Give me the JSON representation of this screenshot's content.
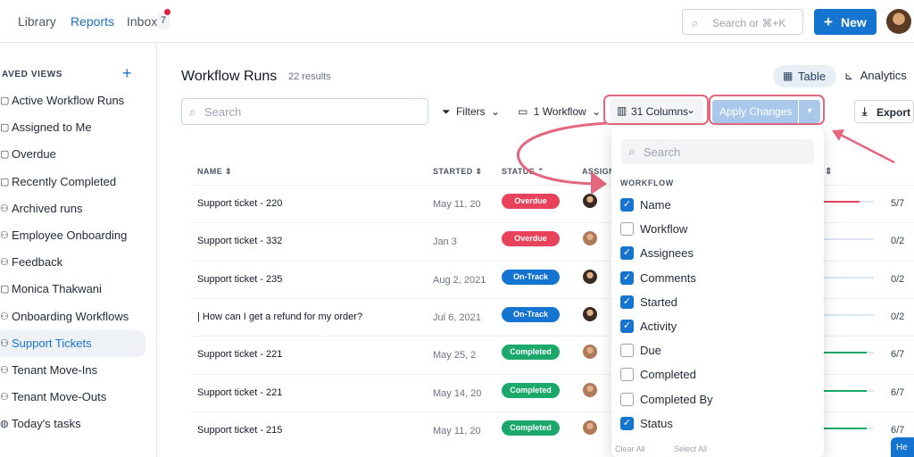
{
  "topbar": {
    "nav": [
      "Library",
      "Reports",
      "Inbox"
    ],
    "inbox_count": "7",
    "search_placeholder": "Search or ⌘+K",
    "new_label": "New"
  },
  "sidebar": {
    "title": "AVED VIEWS",
    "items": [
      {
        "label": "Active Workflow Runs",
        "icon": "view-icon"
      },
      {
        "label": "Assigned to Me",
        "icon": "view-icon"
      },
      {
        "label": "Overdue",
        "icon": "view-icon"
      },
      {
        "label": "Recently Completed",
        "icon": "view-icon"
      },
      {
        "label": "Archived runs",
        "icon": "people-icon"
      },
      {
        "label": "Employee Onboarding",
        "icon": "people-icon"
      },
      {
        "label": "Feedback",
        "icon": "people-icon"
      },
      {
        "label": "Monica Thakwani",
        "icon": "view-icon"
      },
      {
        "label": "Onboarding Workflows",
        "icon": "people-icon"
      },
      {
        "label": "Support Tickets",
        "icon": "people-icon"
      },
      {
        "label": "Tenant Move-Ins",
        "icon": "people-icon"
      },
      {
        "label": "Tenant Move-Outs",
        "icon": "people-icon"
      },
      {
        "label": "Today's tasks",
        "icon": "globe-icon"
      }
    ],
    "active_index": 9
  },
  "main": {
    "title": "Workflow Runs",
    "results": "22 results",
    "view_table": "Table",
    "view_analytics": "Analytics",
    "search_placeholder": "Search",
    "filters_label": "Filters",
    "workflow_label": "1 Workflow",
    "columns_label": "31 Columns",
    "apply_label": "Apply Changes",
    "export_label": "Export",
    "headers": [
      "NAME",
      "STARTED",
      "STATUS",
      "ASSIGN"
    ],
    "rows": [
      {
        "name": "Support ticket - 220",
        "started": "May 11, 20",
        "status": "Overdue",
        "progress": "5/7"
      },
      {
        "name": "Support ticket - 332",
        "started": "Jan 3",
        "status": "Overdue",
        "progress": "0/2"
      },
      {
        "name": "Support ticket - 235",
        "started": "Aug 2, 2021",
        "status": "On-Track",
        "progress": "0/2"
      },
      {
        "name": "| How can I get a refund for my order?",
        "started": "Jul 6, 2021",
        "status": "On-Track",
        "progress": "0/2"
      },
      {
        "name": "Support ticket - 221",
        "started": "May 25, 2",
        "status": "Completed",
        "progress": "6/7"
      },
      {
        "name": "Support ticket - 221",
        "started": "May 14, 20",
        "status": "Completed",
        "progress": "6/7"
      },
      {
        "name": "Support ticket - 215",
        "started": "May 11, 20",
        "status": "Completed",
        "progress": "6/7"
      }
    ],
    "status_colors": {
      "Overdue": "#e8435a",
      "On-Track": "#1574d0",
      "Completed": "#1aa96a"
    }
  },
  "column_picker": {
    "search_placeholder": "Search",
    "section": "WORKFLOW",
    "options": [
      {
        "label": "Name",
        "checked": true
      },
      {
        "label": "Workflow",
        "checked": false
      },
      {
        "label": "Assignees",
        "checked": true
      },
      {
        "label": "Comments",
        "checked": true
      },
      {
        "label": "Started",
        "checked": true
      },
      {
        "label": "Activity",
        "checked": true
      },
      {
        "label": "Due",
        "checked": false
      },
      {
        "label": "Completed",
        "checked": false
      },
      {
        "label": "Completed By",
        "checked": false
      },
      {
        "label": "Status",
        "checked": true
      }
    ],
    "clear_all": "Clear All",
    "select_all": "Select All"
  },
  "help_label": "He"
}
